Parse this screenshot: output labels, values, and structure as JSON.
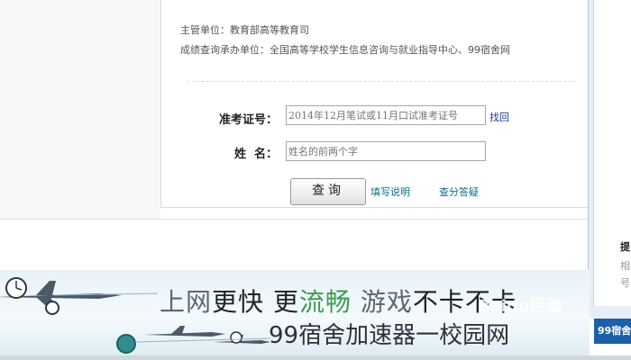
{
  "info": {
    "authority": "主管单位：教育部高等教育司",
    "organizer": "成绩查询承办单位：全国高等学校学生信息咨询与就业指导中心、99宿舍网"
  },
  "form": {
    "ticket_label": "准考证号：",
    "ticket_placeholder": "2014年12月笔试或11月口试准考证号",
    "find_link": "找回",
    "name_label": "姓  名：",
    "name_placeholder": "姓名的前两个字",
    "query_button": "查询",
    "fill_instructions_link": "填写说明",
    "answers_link": "查分答疑"
  },
  "side_window": {
    "heading": "提",
    "line1": "相",
    "line2": "号",
    "tab_label": "99宿舍"
  },
  "banner": {
    "line1_a": "上网",
    "line1_b": "更快",
    "line1_c": "更",
    "line1_d": "流畅",
    "line1_e": "游戏",
    "line1_f": "不卡不卡",
    "line2": "99宿舍加速器一校园网",
    "watermark": "Baidu经验"
  }
}
